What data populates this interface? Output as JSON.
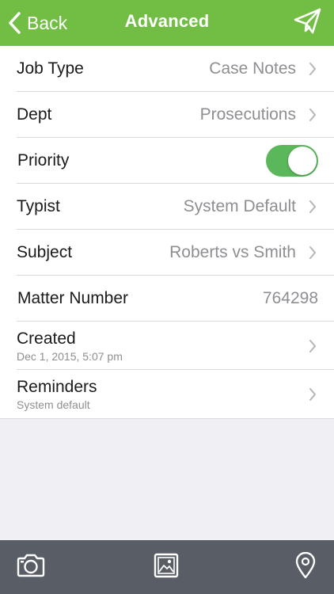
{
  "header": {
    "back_label": "Back",
    "title": "Advanced",
    "send_icon": "paper-plane-icon",
    "background": "#72be44"
  },
  "rows": [
    {
      "label": "Job Type",
      "value": "Case Notes",
      "has_chevron": true
    },
    {
      "label": "Dept",
      "value": "Prosecutions",
      "has_chevron": true
    },
    {
      "label": "Priority",
      "toggle": true,
      "toggle_on": true
    },
    {
      "label": "Typist",
      "value": "System Default",
      "has_chevron": true
    },
    {
      "label": "Subject",
      "value": "Roberts vs Smith",
      "has_chevron": true
    },
    {
      "label": "Matter Number",
      "value": "764298",
      "has_chevron": false
    },
    {
      "label": "Created",
      "sub": "Dec 1, 2015, 5:07 pm",
      "has_chevron": true
    },
    {
      "label": "Reminders",
      "sub": "System default",
      "has_chevron": true
    }
  ],
  "toolbar": {
    "items": [
      "camera-icon",
      "image-gallery-icon",
      "location-pin-icon"
    ],
    "background": "#585d66"
  },
  "colors": {
    "accent_green": "#72be44",
    "toggle_green": "#5bb85a",
    "secondary_text": "#8e8e93"
  }
}
